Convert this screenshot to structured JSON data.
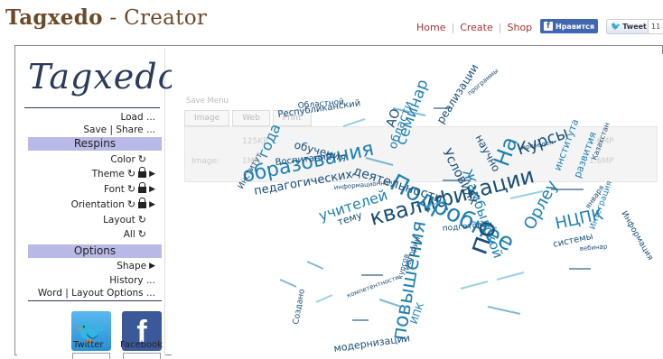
{
  "header": {
    "title_main": "Tagxedo",
    "title_sep": " - ",
    "title_sub": "Creator",
    "nav": [
      "Home",
      "Create",
      "Shop"
    ],
    "fb_like": "Нравится",
    "tweet": "Tweet",
    "tweet_count": "11"
  },
  "sidebar": {
    "brand": "Tagxedo",
    "load": "Load ...",
    "save_share": "Save | Share ...",
    "respins_title": "Respins",
    "color": "Color",
    "theme": "Theme",
    "font": "Font",
    "orientation": "Orientation",
    "layout": "Layout",
    "all": "All",
    "options_title": "Options",
    "shape": "Shape",
    "history": "History ...",
    "word_layout": "Word | Layout Options ...",
    "twitter": "Twitter",
    "facebook": "Facebook"
  },
  "save_menu": {
    "header": "Save Menu",
    "tabs": [
      "Image",
      "Web",
      "Print"
    ],
    "image_label": "Image:",
    "sizes": [
      "125KP",
      "1MP"
    ],
    "sizes_right": [
      "1.6MP",
      "1.6MP"
    ]
  },
  "colors": {
    "accent_blue": "#1f7fb4",
    "dark_blue": "#1a4e76",
    "light_blue": "#4aa8d8",
    "section_bg": "#b9b9e8",
    "title_brown": "#6b4a2a"
  },
  "cloud": [
    {
      "t": "повышения"
    },
    {
      "t": "квалификации"
    },
    {
      "t": "Подробнее"
    },
    {
      "t": "образования"
    },
    {
      "t": "по"
    },
    {
      "t": "На"
    },
    {
      "t": "Курсы"
    },
    {
      "t": "НЦПК"
    },
    {
      "t": "педагогических"
    },
    {
      "t": "учителей"
    },
    {
      "t": "деятельности"
    },
    {
      "t": "семинар"
    },
    {
      "t": "обучения"
    },
    {
      "t": "Республиканский"
    },
    {
      "t": "Областной"
    },
    {
      "t": "Жамбылской"
    },
    {
      "t": "Условиях"
    },
    {
      "t": "Орлеу"
    },
    {
      "t": "года"
    },
    {
      "t": "области"
    },
    {
      "t": "АО"
    },
    {
      "t": "развития"
    },
    {
      "t": "системы"
    },
    {
      "t": "Интеграция"
    },
    {
      "t": "модернизации"
    },
    {
      "t": "ИПК"
    },
    {
      "t": "Создано"
    },
    {
      "t": "тему"
    },
    {
      "t": "Воспитание"
    },
    {
      "t": "Институт"
    },
    {
      "t": "подготовки"
    },
    {
      "t": "истории"
    },
    {
      "t": "реализации"
    },
    {
      "t": "научно"
    },
    {
      "t": "института"
    },
    {
      "t": "проведен"
    },
    {
      "t": "Казахстан"
    },
    {
      "t": "января"
    },
    {
      "t": "вебинар"
    },
    {
      "t": "Информация"
    },
    {
      "t": "программы"
    },
    {
      "t": "курсов"
    },
    {
      "t": "информационная"
    },
    {
      "t": "компетентности"
    }
  ]
}
